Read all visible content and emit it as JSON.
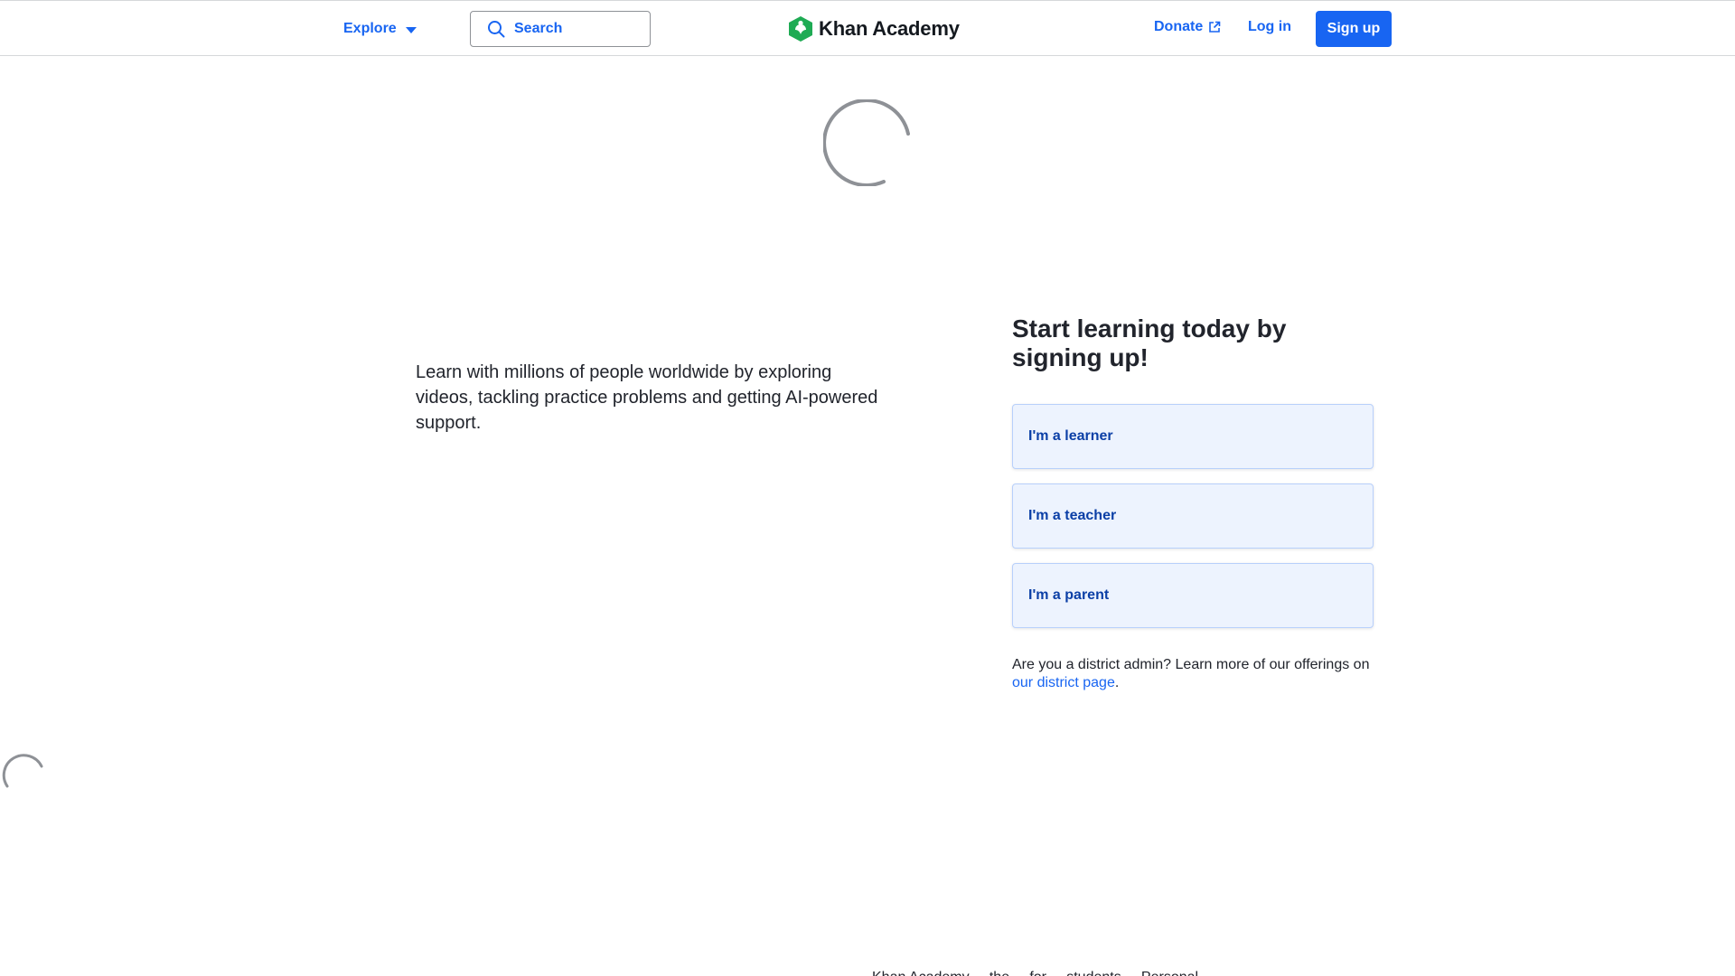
{
  "header": {
    "explore_label": "Explore",
    "search_placeholder": "Search",
    "logo_text": "Khan Academy",
    "donate_label": "Donate",
    "login_label": "Log in",
    "signup_label": "Sign up"
  },
  "intro": {
    "text": "Learn with millions of people worldwide by exploring videos, tackling practice problems and getting AI-powered support."
  },
  "signup_panel": {
    "heading": "Start learning today by signing up!",
    "roles": [
      {
        "label": "I'm a learner"
      },
      {
        "label": "I'm a teacher"
      },
      {
        "label": "I'm a parent"
      }
    ],
    "district_text": "Are you a district admin? Learn more of our offerings on ",
    "district_link": "our district page",
    "district_end": "."
  },
  "footer_clip": {
    "text": "Khan Academy ... the ... for ... students ... Personal ..."
  },
  "colors": {
    "brand_blue": "#1865f2",
    "logo_green": "#1fab54",
    "role_bg": "#edf3fe",
    "spinner_gray": "#8e9196"
  },
  "icons": {
    "search": "search-icon",
    "explore_caret": "caret-down-icon",
    "donate_external": "external-link-icon",
    "logo": "khan-hexagon-logo-icon",
    "spinner": "loading-spinner-icon"
  }
}
